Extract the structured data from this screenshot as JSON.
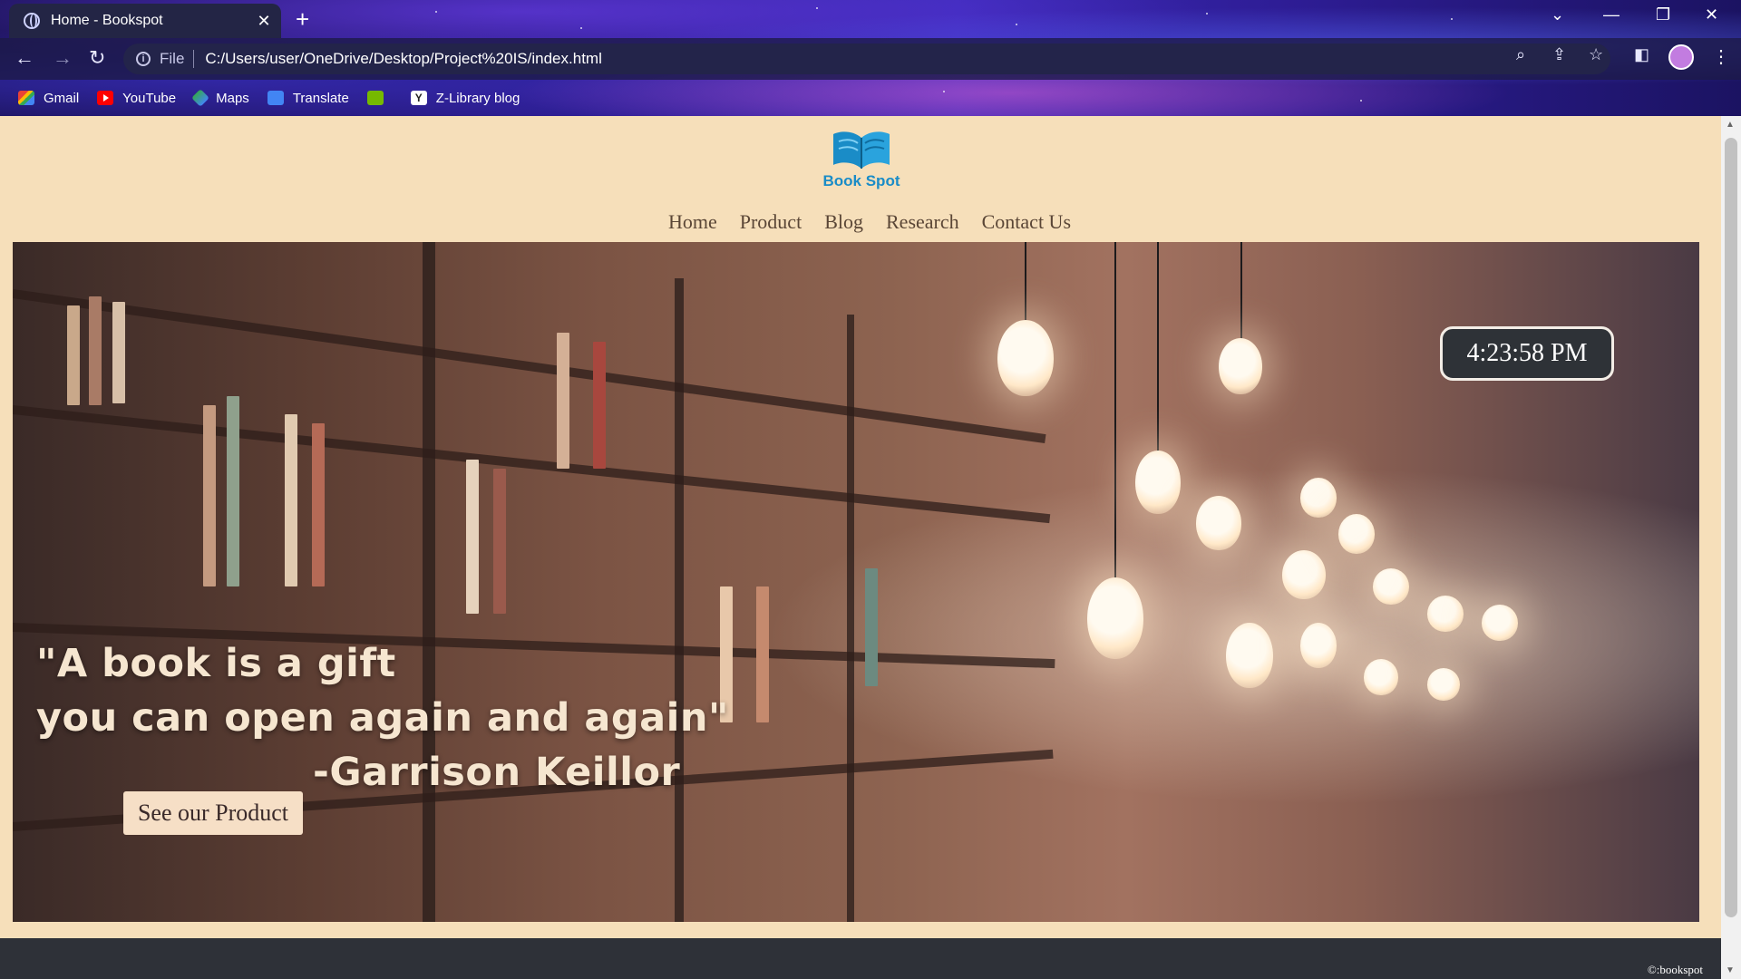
{
  "browser": {
    "tab_title": "Home - Bookspot",
    "tab_close": "✕",
    "new_tab": "+",
    "url_scheme_label": "File",
    "url": "C:/Users/user/OneDrive/Desktop/Project%20IS/index.html",
    "bookmarks": [
      {
        "label": "Gmail",
        "icon": "gmail-icon"
      },
      {
        "label": "YouTube",
        "icon": "youtube-icon"
      },
      {
        "label": "Maps",
        "icon": "maps-icon"
      },
      {
        "label": "Translate",
        "icon": "translate-icon"
      },
      {
        "label": "",
        "icon": "nvidia-icon"
      },
      {
        "label": "Z-Library blog",
        "icon": "zlibrary-icon"
      }
    ]
  },
  "site": {
    "brand": "Book Spot",
    "nav": [
      "Home",
      "Product",
      "Blog",
      "Research",
      "Contact Us"
    ],
    "clock": "4:23:58 PM",
    "quote_line1": "\"A book is a gift",
    "quote_line2": "you can open again and again\"",
    "quote_author": "-Garrison Keillor",
    "cta": "See our Product",
    "copyright": "©:bookspot",
    "colors": {
      "page_bg": "#f6dfba",
      "nav_text": "#5a4636",
      "brand": "#1a8cc7",
      "footer": "#2e3138"
    }
  }
}
